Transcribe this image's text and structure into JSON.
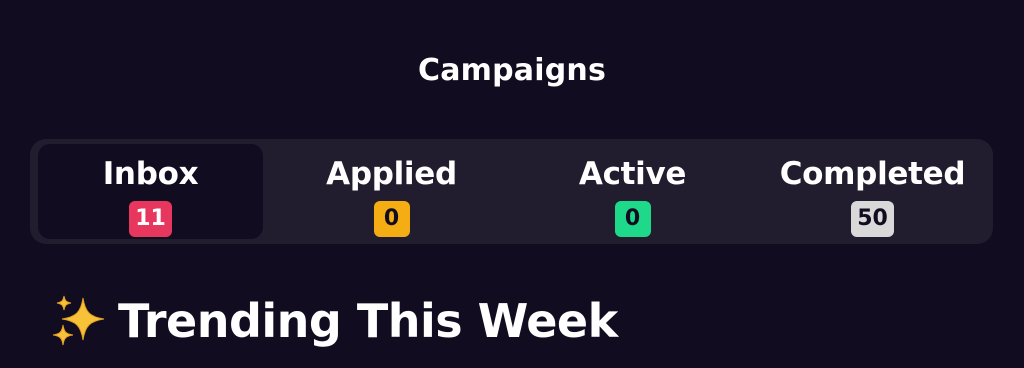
{
  "header": {
    "title": "Campaigns"
  },
  "tabs": [
    {
      "label": "Inbox",
      "count": "11",
      "badge_color": "#e7375f",
      "badge_text_color": "#ffffff",
      "selected": true
    },
    {
      "label": "Applied",
      "count": "0",
      "badge_color": "#f4ad12",
      "badge_text_color": "#120c20",
      "selected": false
    },
    {
      "label": "Active",
      "count": "0",
      "badge_color": "#1ed98a",
      "badge_text_color": "#120c20",
      "selected": false
    },
    {
      "label": "Completed",
      "count": "50",
      "badge_color": "#d9d9d9",
      "badge_text_color": "#120c20",
      "selected": false
    }
  ],
  "trending": {
    "icon": "sparkles-icon",
    "title": "Trending This Week"
  },
  "colors": {
    "background": "#120c20",
    "tab_bar": "#211c2e",
    "text": "#ffffff"
  }
}
